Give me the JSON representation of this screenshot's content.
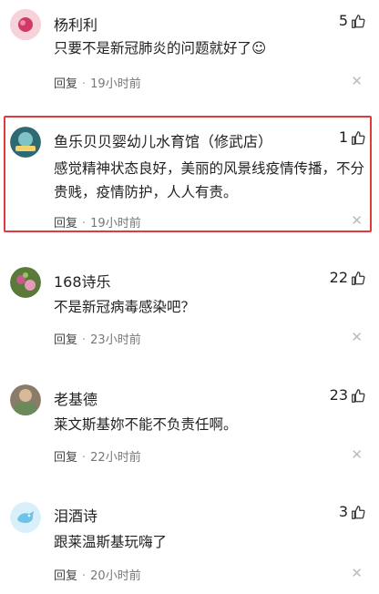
{
  "comments": [
    {
      "username": "杨利利",
      "likes": "5",
      "text": "只要不是新冠肺炎的问题就好了☺",
      "reply": "回复",
      "time": "19小时前",
      "highlighted": false
    },
    {
      "username": "鱼乐贝贝婴幼儿水育馆（修武店）",
      "likes": "1",
      "text": "感觉精神状态良好，美丽的风景线疫情传播，不分贵贱，疫情防护，人人有责。",
      "reply": "回复",
      "time": "19小时前",
      "highlighted": true
    },
    {
      "username": "168诗乐",
      "likes": "22",
      "text": "不是新冠病毒感染吧？",
      "reply": "回复",
      "time": "23小时前",
      "highlighted": false
    },
    {
      "username": "老基德",
      "likes": "23",
      "text": "莱文斯基妳不能不负责任啊。",
      "reply": "回复",
      "time": "22小时前",
      "highlighted": false
    },
    {
      "username": "泪酒诗",
      "likes": "3",
      "text": "跟莱温斯基玩嗨了",
      "reply": "回复",
      "time": "20小时前",
      "highlighted": false
    }
  ],
  "colors": {
    "highlight_border": "#e0393e",
    "meta": "#777777",
    "text": "#222222"
  },
  "icons": {
    "like": "thumbs-up-icon",
    "dismiss": "close-icon"
  }
}
